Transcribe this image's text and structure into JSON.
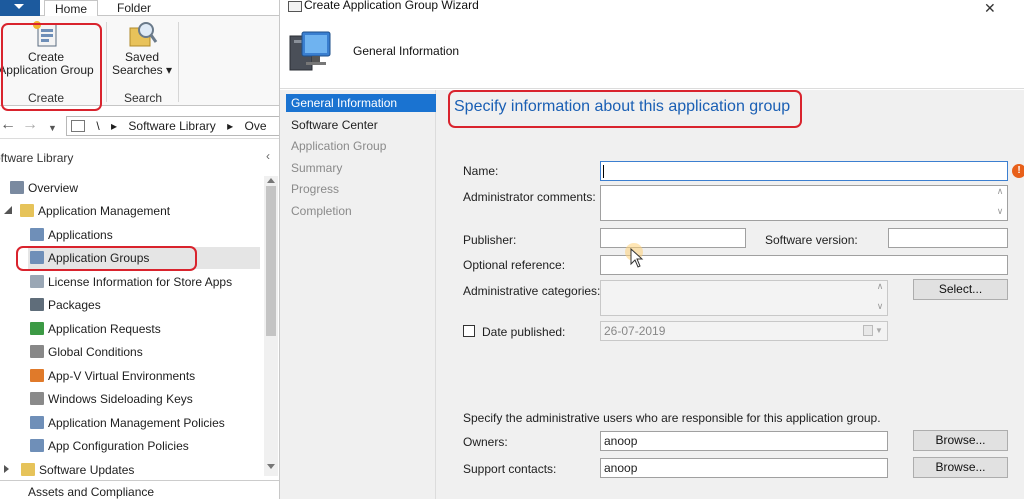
{
  "console": {
    "ribbon_tabs": [
      "Home",
      "Folder"
    ],
    "ribbon": {
      "create_app_group_label": [
        "Create",
        "Application Group"
      ],
      "saved_searches_label": [
        "Saved",
        "Searches ▾"
      ],
      "group_create": "Create",
      "group_search": "Search"
    },
    "breadcrumb": [
      "\\",
      "▸",
      "Software Library",
      "▸",
      "Ove"
    ],
    "workspace_title": "oftware Library",
    "tree": [
      {
        "label": "Overview",
        "icon": "overview-icon",
        "color": "#7a8aa0"
      },
      {
        "label": "Application Management",
        "icon": "folder-icon",
        "color": "#e6c35a"
      },
      {
        "label": "Applications",
        "icon": "applications-icon",
        "color": "#6f8fb8"
      },
      {
        "label": "Application Groups",
        "icon": "application-groups-icon",
        "color": "#6f8fb8"
      },
      {
        "label": "License Information for Store Apps",
        "icon": "license-icon",
        "color": "#9aa7b5"
      },
      {
        "label": "Packages",
        "icon": "packages-icon",
        "color": "#5f6d7a"
      },
      {
        "label": "Application Requests",
        "icon": "requests-icon",
        "color": "#3c9a45"
      },
      {
        "label": "Global Conditions",
        "icon": "global-conditions-icon",
        "color": "#888888"
      },
      {
        "label": "App-V Virtual Environments",
        "icon": "appv-icon",
        "color": "#e07a2a"
      },
      {
        "label": "Windows Sideloading Keys",
        "icon": "key-icon",
        "color": "#8a8a8a"
      },
      {
        "label": "Application Management Policies",
        "icon": "policy-icon",
        "color": "#6f8fb8"
      },
      {
        "label": "App Configuration Policies",
        "icon": "config-policy-icon",
        "color": "#6f8fb8"
      },
      {
        "label": "Software Updates",
        "icon": "folder-icon",
        "color": "#e6c35a"
      }
    ],
    "bottom_item": "Assets and Compliance"
  },
  "wizard": {
    "title": "Create Application Group Wizard",
    "close_glyph": "✕",
    "header_title": "General Information",
    "steps": [
      "General Information",
      "Software Center",
      "Application Group",
      "Summary",
      "Progress",
      "Completion"
    ],
    "heading": "Specify information about this application group",
    "fields": {
      "name_label": "Name:",
      "name_value": "",
      "admin_comments_label": "Administrator comments:",
      "publisher_label": "Publisher:",
      "publisher_value": "",
      "software_version_label": "Software version:",
      "software_version_value": "",
      "optional_reference_label": "Optional reference:",
      "optional_reference_value": "",
      "admin_categories_label": "Administrative categories:",
      "select_button": "Select...",
      "date_published_label": "Date published:",
      "date_published_value": "26-07-2019",
      "owners_note": "Specify the administrative users who are responsible for this application group.",
      "owners_label": "Owners:",
      "owners_value": "anoop",
      "support_contacts_label": "Support contacts:",
      "support_contacts_value": "anoop",
      "browse_button": "Browse...",
      "error_glyph": "!"
    }
  },
  "colors": {
    "accent": "#1a73d1",
    "highlight": "#d9232d",
    "heading": "#1a5fb4"
  }
}
